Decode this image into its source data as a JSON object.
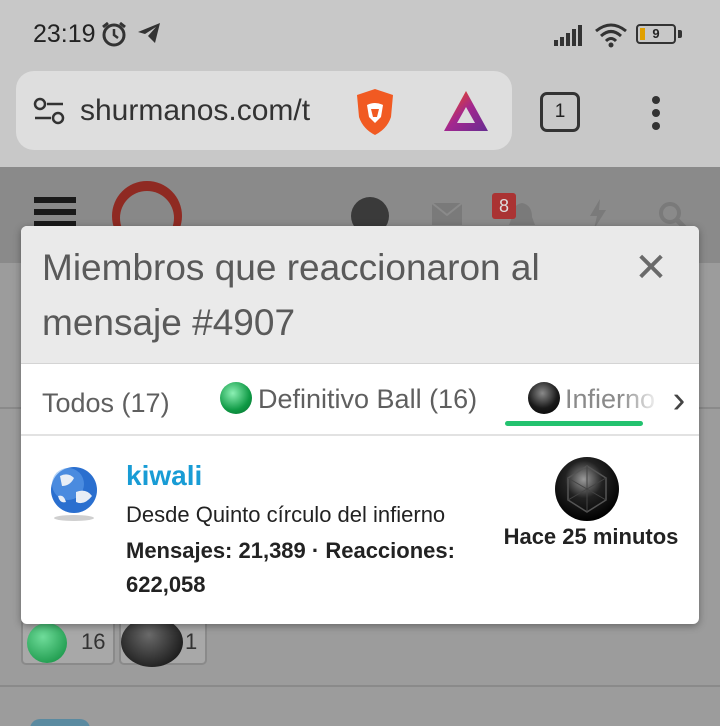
{
  "status_bar": {
    "time": "23:19",
    "battery_level": "9",
    "icons": [
      "alarm-icon",
      "telegram-icon",
      "signal-icon",
      "wifi-icon",
      "battery-icon"
    ]
  },
  "browser": {
    "url": "shurmanos.com/t",
    "tab_count": "1",
    "icons": [
      "site-settings-icon",
      "brave-shields-icon",
      "brave-rewards-icon",
      "overflow-menu-icon"
    ]
  },
  "forum": {
    "notification_count": "8",
    "reactions": [
      {
        "type": "Definitivo Ball",
        "count": "16"
      },
      {
        "type": "Infierno",
        "count": "1"
      }
    ]
  },
  "modal": {
    "title": "Miembros que reaccionaron al mensaje #4907",
    "tabs": [
      {
        "label": "Todos (17)",
        "icon": null,
        "active": false
      },
      {
        "label": "Definitivo Ball (16)",
        "icon": "green-ball-icon",
        "active": false
      },
      {
        "label": "Infierno",
        "icon": "black-ball-icon",
        "active": true
      }
    ],
    "members": [
      {
        "name": "kiwali",
        "user_title": "Desde Quinto círculo del infierno",
        "stats_line": "Mensajes: 21,389 · Reacciones: 622,058",
        "reaction_icon": "black-ball-icon",
        "time": "Hace 25 minutos"
      }
    ]
  },
  "colors": {
    "accent_green": "#23c26f",
    "username_blue": "#189cd5",
    "overlay_gray": "#9c9c9c"
  }
}
